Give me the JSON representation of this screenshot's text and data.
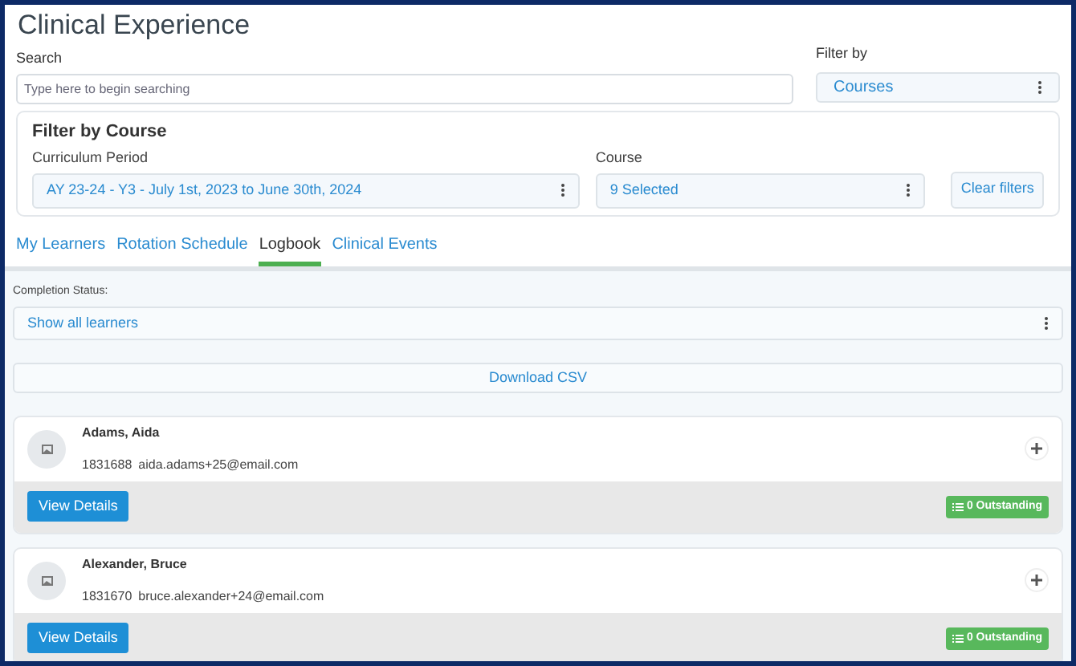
{
  "page": {
    "title": "Clinical Experience"
  },
  "search": {
    "label": "Search",
    "placeholder": "Type here to begin searching"
  },
  "filter_by": {
    "label": "Filter by",
    "value": "Courses"
  },
  "course_filter": {
    "title": "Filter by Course",
    "curriculum_label": "Curriculum Period",
    "curriculum_value": "AY 23-24 - Y3 - July 1st, 2023 to June 30th, 2024",
    "course_label": "Course",
    "course_value": "9 Selected",
    "clear_button": "Clear filters"
  },
  "tabs": [
    {
      "label": "My Learners",
      "selected": false
    },
    {
      "label": "Rotation Schedule",
      "selected": false
    },
    {
      "label": "Logbook",
      "selected": true
    },
    {
      "label": "Clinical Events",
      "selected": false
    }
  ],
  "completion_status": {
    "label": "Completion Status:",
    "value": "Show all learners"
  },
  "download_button": "Download CSV",
  "learners": [
    {
      "name": "Adams, Aida",
      "id": "1831688",
      "email": "aida.adams+25@email.com",
      "button": "View Details",
      "outstanding": "0 Outstanding"
    },
    {
      "name": "Alexander, Bruce",
      "id": "1831670",
      "email": "bruce.alexander+24@email.com",
      "button": "View Details",
      "outstanding": "0 Outstanding"
    }
  ]
}
